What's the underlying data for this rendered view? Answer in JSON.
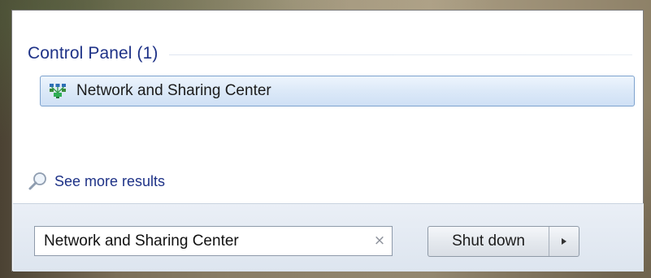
{
  "search_results": {
    "group_title": "Control Panel (1)",
    "items": [
      {
        "label": "Network and Sharing Center",
        "icon": "network-icon"
      }
    ],
    "see_more_label": "See more results",
    "see_more_icon": "search-icon"
  },
  "search_bar": {
    "value": "Network and Sharing Center",
    "clear_icon": "×"
  },
  "power": {
    "shutdown_label": "Shut down",
    "options_icon": "arrow-right-icon"
  },
  "colors": {
    "group_title": "#1e3287",
    "link": "#1e3287",
    "highlight_border": "#7da2ce",
    "highlight_fill": "#dce9f8",
    "bottom_bar": "#e3eaf2"
  }
}
